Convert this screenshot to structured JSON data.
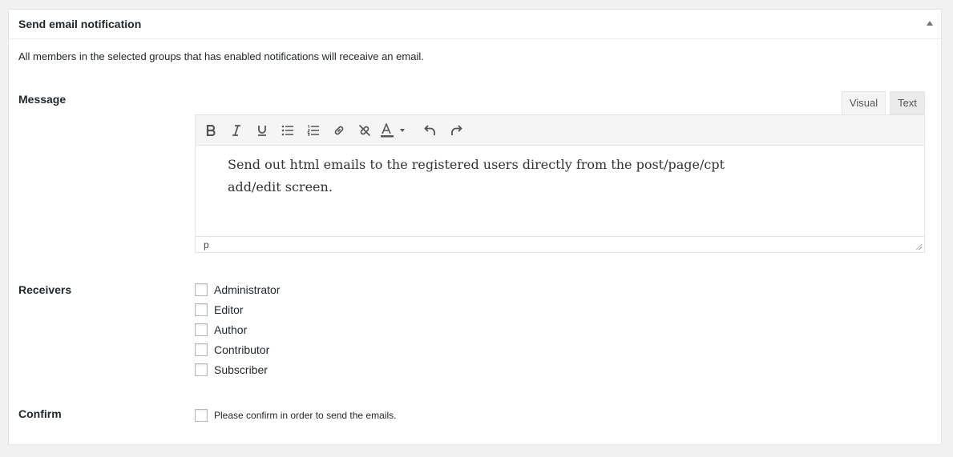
{
  "panel": {
    "title": "Send email notification",
    "description": "All members in the selected groups that has enabled notifications will receaive an email."
  },
  "message": {
    "label": "Message",
    "tabs": {
      "visual": "Visual",
      "text": "Text"
    },
    "toolbar": [
      "bold-icon",
      "italic-icon",
      "underline-icon",
      "bullet-list-icon",
      "numbered-list-icon",
      "link-icon",
      "unlink-icon",
      "text-color-icon",
      "undo-icon",
      "redo-icon"
    ],
    "content_line1": "Send out html emails to the registered users directly from the post/page/cpt",
    "content_line2": "add/edit screen.",
    "status_path": "p"
  },
  "receivers": {
    "label": "Receivers",
    "options": [
      "Administrator",
      "Editor",
      "Author",
      "Contributor",
      "Subscriber"
    ]
  },
  "confirm": {
    "label": "Confirm",
    "text": "Please confirm in order to send the emails."
  }
}
